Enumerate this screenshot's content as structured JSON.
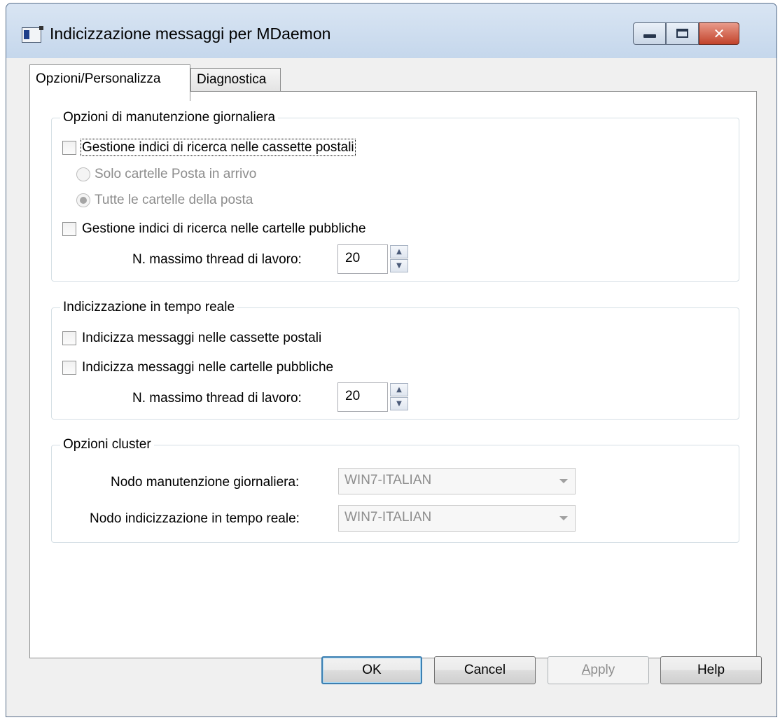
{
  "window": {
    "title": "Indicizzazione messaggi per MDaemon",
    "close_glyph": "✕"
  },
  "tabs": [
    {
      "label": "Opzioni/Personalizza",
      "active": true
    },
    {
      "label": "Diagnostica",
      "active": false
    }
  ],
  "daily_maintenance": {
    "legend": "Opzioni di manutenzione giornaliera",
    "mailbox_index_label": "Gestione indici di ricerca nelle cassette postali",
    "mailbox_index_checked": false,
    "inbox_only_label": "Solo cartelle Posta in arrivo",
    "all_folders_label": "Tutte le cartelle della posta",
    "selected_radio": "all_folders",
    "public_index_label": "Gestione indici di ricerca nelle cartelle pubbliche",
    "public_index_checked": false,
    "max_threads_label": "N. massimo thread di lavoro:",
    "max_threads_value": "20"
  },
  "realtime": {
    "legend": "Indicizzazione in tempo reale",
    "mailbox_label": "Indicizza messaggi nelle cassette postali",
    "mailbox_checked": false,
    "public_label": "Indicizza messaggi nelle cartelle pubbliche",
    "public_checked": false,
    "max_threads_label": "N. massimo thread di lavoro:",
    "max_threads_value": "20"
  },
  "cluster": {
    "legend": "Opzioni cluster",
    "daily_node_label": "Nodo manutenzione giornaliera:",
    "daily_node_value": "WIN7-ITALIAN",
    "realtime_node_label": "Nodo indicizzazione in tempo reale:",
    "realtime_node_value": "WIN7-ITALIAN"
  },
  "buttons": {
    "ok": "OK",
    "cancel": "Cancel",
    "apply_prefix": "A",
    "apply_rest": "pply",
    "help": "Help"
  },
  "spin_glyphs": {
    "up": "▲",
    "down": "▼"
  }
}
